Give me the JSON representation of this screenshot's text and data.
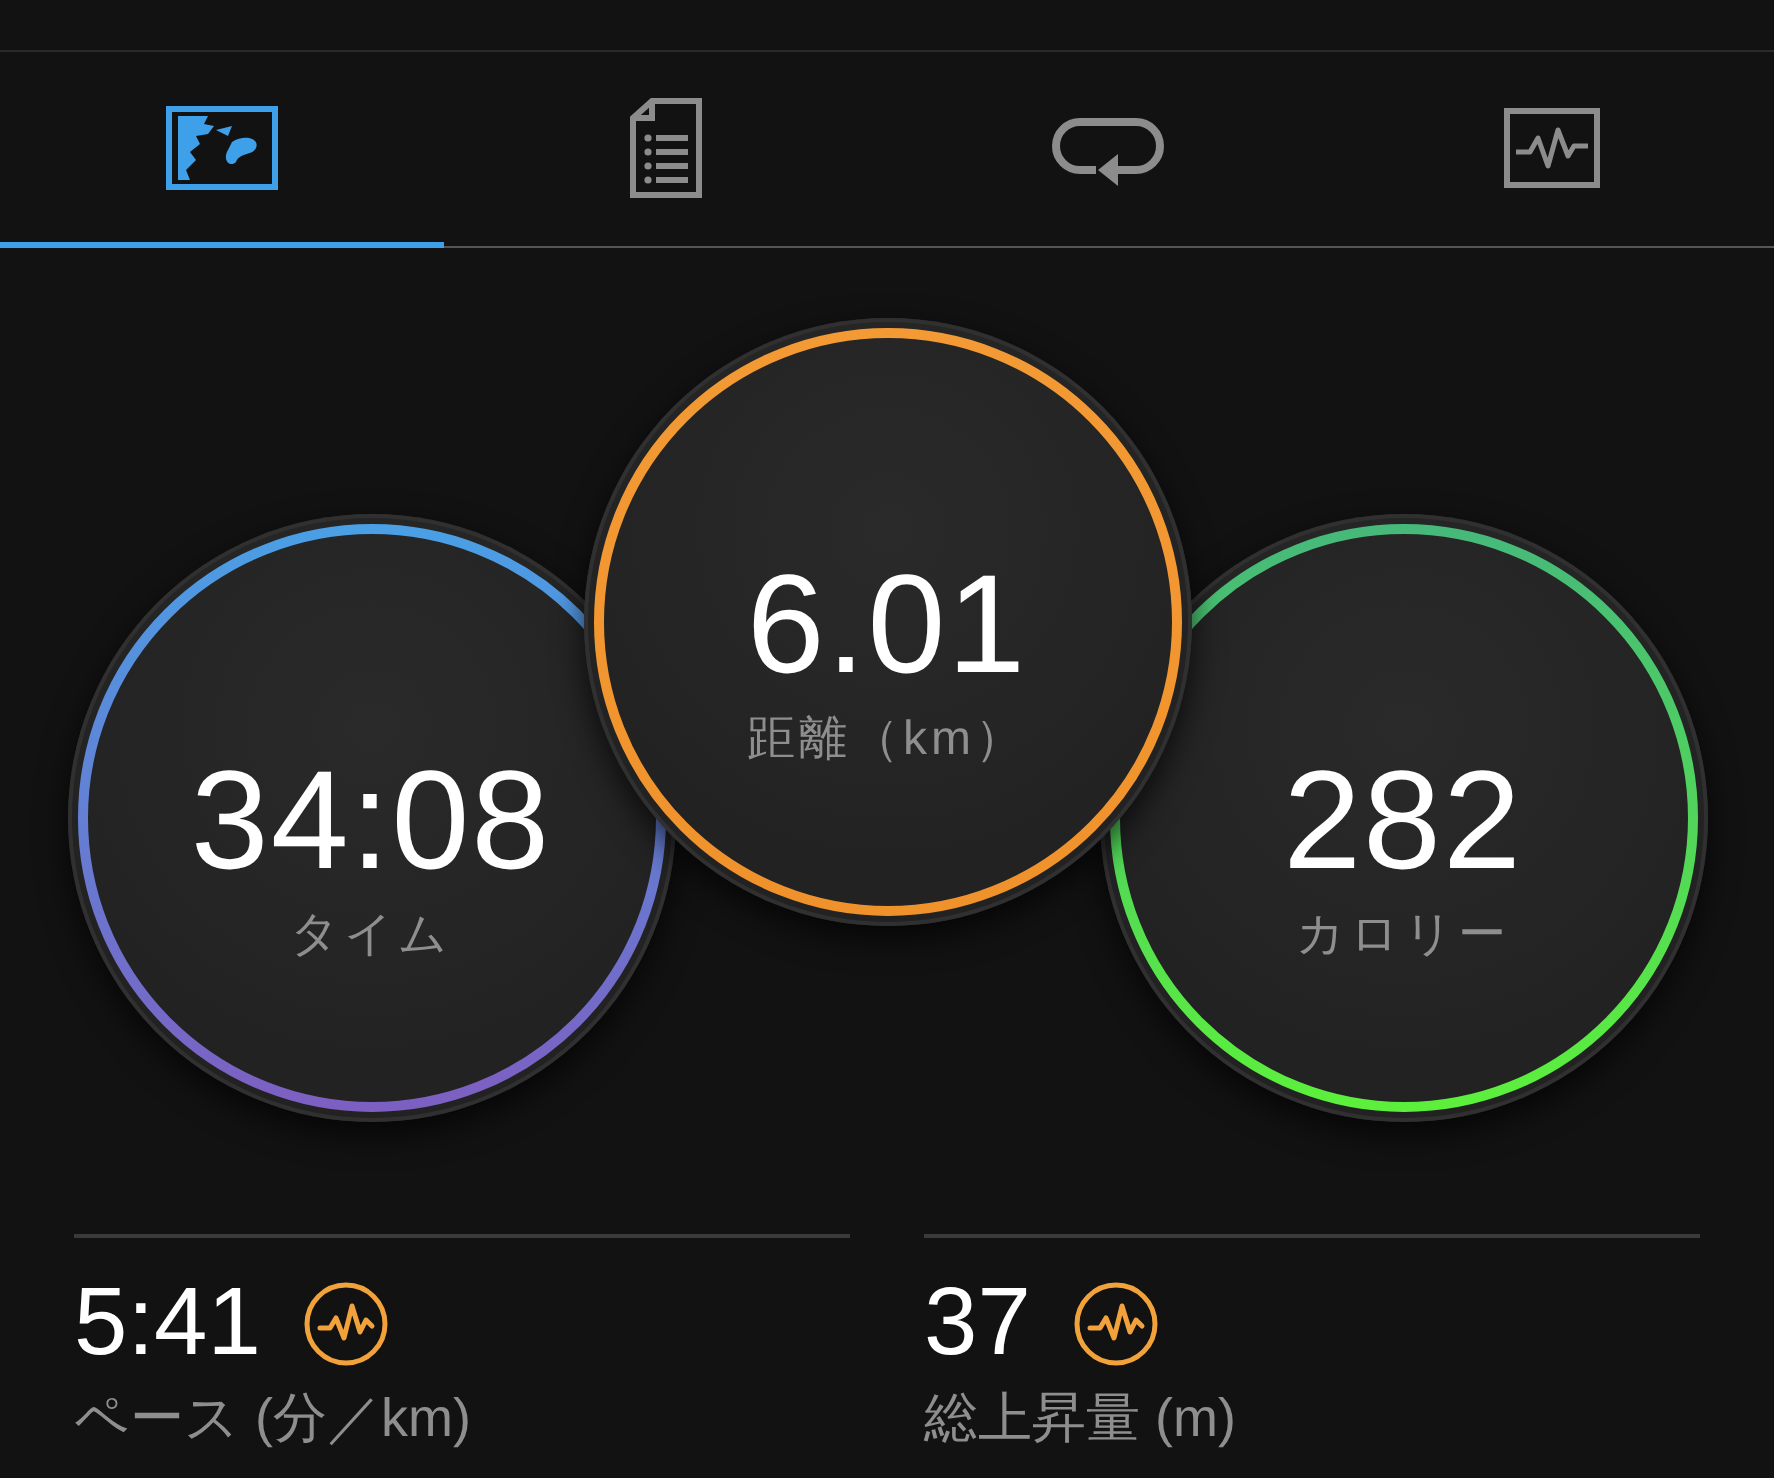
{
  "tabs": [
    {
      "selected": true
    },
    {
      "selected": false
    },
    {
      "selected": false
    },
    {
      "selected": false
    }
  ],
  "metrics": [
    {
      "value": "34:08",
      "label": "タイム",
      "ring_stops": [
        {
          "color": "#4a9fe5"
        },
        {
          "color": "#7d5fc2"
        }
      ]
    },
    {
      "value": "6.01",
      "label": "距離（km）",
      "ring_stops": [
        {
          "color": "#f39a34"
        },
        {
          "color": "#f0922c"
        }
      ]
    },
    {
      "value": "282",
      "label": "カロリー",
      "ring_stops": [
        {
          "color": "#46b97a"
        },
        {
          "color": "#5cf03c"
        }
      ]
    }
  ],
  "stats": [
    {
      "value": "5:41",
      "label": "ペース (分／km)"
    },
    {
      "value": "37",
      "label": "総上昇量 (m)"
    }
  ]
}
